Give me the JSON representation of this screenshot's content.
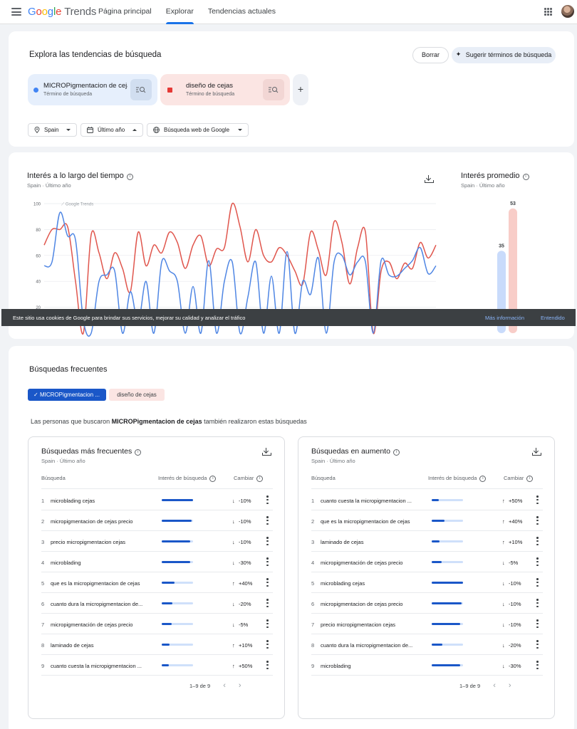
{
  "header": {
    "logo_google": "Google",
    "logo_trends": "Trends",
    "nav": [
      {
        "label": "Página principal",
        "active": false
      },
      {
        "label": "Explorar",
        "active": true
      },
      {
        "label": "Tendencias actuales",
        "active": false
      }
    ]
  },
  "explore": {
    "title": "Explora las tendencias de búsqueda",
    "clear_label": "Borrar",
    "suggest_label": "Sugerir términos de búsqueda",
    "terms": [
      {
        "name": "MICROPigmentacion de cejas",
        "type": "Término de búsqueda",
        "color": "#4285f4"
      },
      {
        "name": "diseño de cejas",
        "type": "Término de búsqueda",
        "color": "#e53935"
      }
    ],
    "add_label": "+",
    "filters": {
      "location": "Spain",
      "period": "Último año",
      "search_type": "Búsqueda web de Google"
    }
  },
  "interest": {
    "title": "Interés a lo largo del tiempo",
    "subtitle_location": "Spain",
    "subtitle_period": "Último año",
    "watermark": "Google Trends",
    "avg_title": "Interés promedio",
    "avg_subtitle_location": "Spain",
    "avg_subtitle_period": "Último año"
  },
  "chart_data": {
    "type": "line",
    "yticks": [
      20,
      40,
      60,
      80,
      100
    ],
    "ylim": [
      0,
      100
    ],
    "grid": true,
    "series": [
      {
        "name": "MICROPigmentacion de cejas",
        "color": "#4f86e4",
        "values": [
          52,
          55,
          93,
          75,
          72,
          10,
          0,
          40,
          45,
          48,
          0,
          32,
          8,
          40,
          0,
          55,
          48,
          40,
          0,
          36,
          0,
          56,
          0,
          40,
          55,
          0,
          28,
          55,
          0,
          44,
          0,
          63,
          0,
          40,
          30,
          58,
          0,
          55,
          60,
          45,
          55,
          55,
          0,
          56,
          45,
          44,
          50,
          56,
          66,
          46,
          52
        ]
      },
      {
        "name": "diseño de cejas",
        "color": "#e0564d",
        "values": [
          68,
          80,
          80,
          82,
          40,
          0,
          76,
          62,
          42,
          62,
          50,
          32,
          78,
          52,
          68,
          62,
          78,
          70,
          50,
          68,
          75,
          52,
          65,
          66,
          100,
          82,
          55,
          80,
          60,
          55,
          66,
          60,
          48,
          38,
          78,
          64,
          45,
          86,
          70,
          38,
          66,
          78,
          0,
          48,
          55,
          42,
          54,
          50,
          70,
          58,
          68
        ]
      },
      {
        "name": "avg",
        "values": [
          35,
          53
        ]
      }
    ],
    "averages": [
      {
        "value": 35,
        "label": "35",
        "color": "#c9dbfb"
      },
      {
        "value": 53,
        "label": "53",
        "color": "#f8cdc8"
      }
    ]
  },
  "cookie": {
    "text": "Este sitio usa cookies de Google para brindar sus servicios, mejorar su calidad y analizar el tráfico",
    "more": "Más información",
    "ok": "Entendido"
  },
  "frequent": {
    "title": "Búsquedas frecuentes",
    "chips": [
      "MICROPigmentacion ...",
      "diseño de cejas"
    ],
    "people_prefix": "Las personas que buscaron",
    "people_term": "MICROPigmentacion de cejas",
    "people_suffix": "también realizaron estas búsquedas",
    "panels": [
      {
        "title": "Búsquedas más frecuentes",
        "subtitle_location": "Spain",
        "subtitle_period": "Último año",
        "col_query": "Búsqueda",
        "col_interest": "Interés de búsqueda",
        "col_change": "Cambiar",
        "pager": "1–9 de 9",
        "rows": [
          {
            "n": "1",
            "q": "microblading cejas",
            "interest": 100,
            "dir": "↓",
            "change": "-10%"
          },
          {
            "n": "2",
            "q": "micropigmentacion de cejas precio",
            "interest": 96,
            "dir": "↓",
            "change": "-10%"
          },
          {
            "n": "3",
            "q": "precio micropigmentacion cejas",
            "interest": 92,
            "dir": "↓",
            "change": "-10%"
          },
          {
            "n": "4",
            "q": "microblading",
            "interest": 90,
            "dir": "↓",
            "change": "-30%"
          },
          {
            "n": "5",
            "q": "que es la micropigmentacion de cejas",
            "interest": 42,
            "dir": "↑",
            "change": "+40%"
          },
          {
            "n": "6",
            "q": "cuanto dura la micropigmentacion de...",
            "interest": 34,
            "dir": "↓",
            "change": "-20%"
          },
          {
            "n": "7",
            "q": "micropigmentación de cejas precio",
            "interest": 32,
            "dir": "↓",
            "change": "-5%"
          },
          {
            "n": "8",
            "q": "laminado de cejas",
            "interest": 24,
            "dir": "↑",
            "change": "+10%"
          },
          {
            "n": "9",
            "q": "cuanto cuesta la micropigmentacion ...",
            "interest": 22,
            "dir": "↑",
            "change": "+50%"
          }
        ]
      },
      {
        "title": "Búsquedas en aumento",
        "subtitle_location": "Spain",
        "subtitle_period": "Último año",
        "col_query": "Búsqueda",
        "col_interest": "Interés de búsqueda",
        "col_change": "Cambiar",
        "pager": "1–9 de 9",
        "rows": [
          {
            "n": "1",
            "q": "cuanto cuesta la micropigmentacion ...",
            "interest": 22,
            "dir": "↑",
            "change": "+50%"
          },
          {
            "n": "2",
            "q": "que es la micropigmentacion de cejas",
            "interest": 42,
            "dir": "↑",
            "change": "+40%"
          },
          {
            "n": "3",
            "q": "laminado de cejas",
            "interest": 24,
            "dir": "↑",
            "change": "+10%"
          },
          {
            "n": "4",
            "q": "micropigmentación de cejas precio",
            "interest": 32,
            "dir": "↓",
            "change": "-5%"
          },
          {
            "n": "5",
            "q": "microblading cejas",
            "interest": 100,
            "dir": "↓",
            "change": "-10%"
          },
          {
            "n": "6",
            "q": "micropigmentacion de cejas precio",
            "interest": 96,
            "dir": "↓",
            "change": "-10%"
          },
          {
            "n": "7",
            "q": "precio micropigmentacion cejas",
            "interest": 92,
            "dir": "↓",
            "change": "-10%"
          },
          {
            "n": "8",
            "q": "cuanto dura la micropigmentacion de...",
            "interest": 34,
            "dir": "↓",
            "change": "-20%"
          },
          {
            "n": "9",
            "q": "microblading",
            "interest": 90,
            "dir": "↓",
            "change": "-30%"
          }
        ]
      }
    ]
  }
}
